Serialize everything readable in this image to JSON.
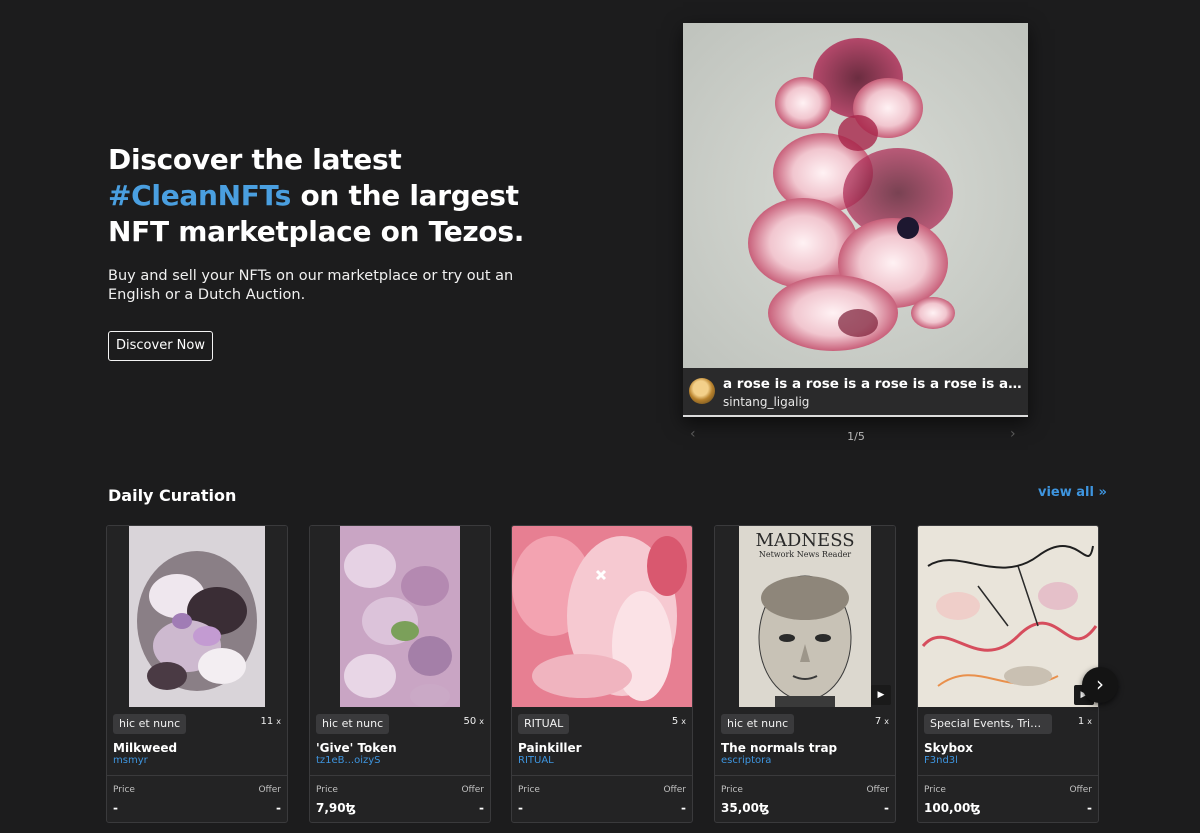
{
  "hero": {
    "title_pre": "Discover the latest ",
    "title_accent": "#CleanNFTs",
    "title_post": " on the largest NFT marketplace on Tezos.",
    "subtitle": "Buy and sell your NFTs on our marketplace or try out an English or a Dutch Auction.",
    "cta_label": "Discover Now",
    "accent_color": "#4a9fe0"
  },
  "featured": {
    "title": "a rose is a rose is a rose is a rose is a rose is a rose",
    "artist": "sintang_ligalig",
    "counter": "1/5",
    "prev_icon": "‹",
    "next_icon": "›"
  },
  "curation": {
    "title": "Daily Curation",
    "view_all": "view all »",
    "next_icon": "›",
    "cards": [
      {
        "tag": "hic et nunc",
        "editions": "11",
        "x": "x",
        "title": "Milkweed",
        "artist": "msmyr",
        "price_label": "Price",
        "offer_label": "Offer",
        "price": "-",
        "offer": "-"
      },
      {
        "tag": "hic et nunc",
        "editions": "50",
        "x": "x",
        "title": "'Give' Token",
        "artist": "tz1eB...oizyS",
        "price_label": "Price",
        "offer_label": "Offer",
        "price": "7,90ꜩ",
        "offer": "-"
      },
      {
        "tag": "RITUAL",
        "editions": "5",
        "x": "x",
        "title": "Painkiller",
        "artist": "RITUAL",
        "price_label": "Price",
        "offer_label": "Offer",
        "price": "-",
        "offer": "-"
      },
      {
        "tag": "hic et nunc",
        "editions": "7",
        "x": "x",
        "title": "The normals trap",
        "artist": "escriptora",
        "price_label": "Price",
        "offer_label": "Offer",
        "price": "35,00ꜩ",
        "offer": "-",
        "art_header": "MADNESS",
        "art_subheader": "Network News Reader"
      },
      {
        "tag": "Special Events, Tribute",
        "editions": "1",
        "x": "x",
        "title": "Skybox",
        "artist": "F3nd3l",
        "price_label": "Price",
        "offer_label": "Offer",
        "price": "100,00ꜩ",
        "offer": "-"
      }
    ]
  }
}
